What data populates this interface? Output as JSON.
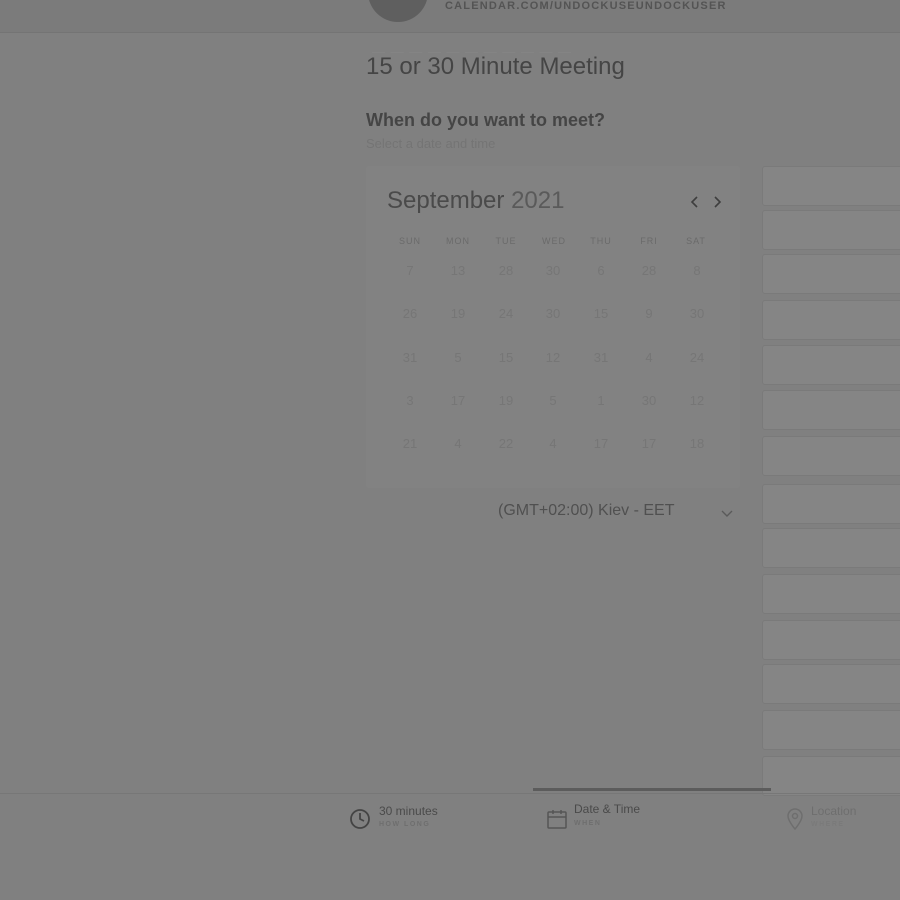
{
  "header": {
    "url": "CALENDAR.COM/UNDOCKUSEUNDOCKUSER",
    "crumb": "— — —  — — — — —  — — —"
  },
  "event": {
    "title": "15 or 30 Minute Meeting",
    "question": "When do you want to meet?",
    "subtitle": "Select a date and time"
  },
  "calendar": {
    "month": "September",
    "year": "2021",
    "weekdays": [
      "SUN",
      "MON",
      "TUE",
      "WED",
      "THU",
      "FRI",
      "SAT"
    ],
    "weeks": [
      [
        "7",
        "13",
        "28",
        "30",
        "6",
        "28",
        "8"
      ],
      [
        "26",
        "19",
        "24",
        "30",
        "15",
        "9",
        "30"
      ],
      [
        "31",
        "5",
        "15",
        "12",
        "31",
        "4",
        "24"
      ],
      [
        "3",
        "17",
        "19",
        "5",
        "1",
        "30",
        "12"
      ],
      [
        "21",
        "4",
        "22",
        "4",
        "17",
        "17",
        "18"
      ]
    ]
  },
  "timezone": {
    "value": "(GMT+02:00) Kiev - EET"
  },
  "steps": [
    {
      "label": "30 minutes",
      "sub": "HOW LONG",
      "icon": "clock-icon"
    },
    {
      "label": "Date & Time",
      "sub": "WHEN",
      "icon": "calendar-icon"
    },
    {
      "label": "Location",
      "sub": "WHERE",
      "icon": "location-pin-icon"
    }
  ],
  "colors": {
    "overlay": "#808080",
    "progress": "#5c5c5c"
  }
}
